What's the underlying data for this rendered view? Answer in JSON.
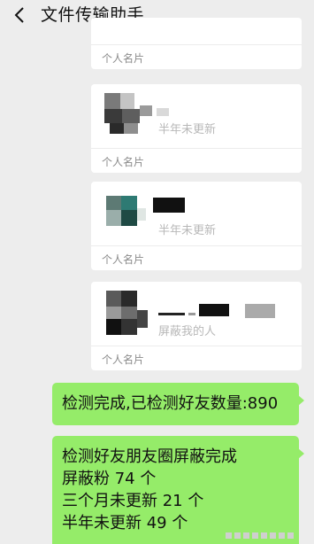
{
  "header": {
    "title": "文件传输助手",
    "back_icon": "chevron-left-icon"
  },
  "cards": [
    {
      "label": "个人名片",
      "status": ""
    },
    {
      "label": "个人名片",
      "status": "半年未更新"
    },
    {
      "label": "个人名片",
      "status": "半年未更新"
    },
    {
      "label": "个人名片",
      "status": "屏蔽我的人"
    }
  ],
  "messages": [
    {
      "lines": [
        "检测完成,已检测好友数量:890"
      ]
    },
    {
      "lines": [
        "检测好友朋友圈屏蔽完成",
        "屏蔽粉 74 个",
        "三个月未更新 21 个",
        "半年未更新 49 个"
      ]
    }
  ],
  "colors": {
    "background": "#ededed",
    "bubble": "#95ec69",
    "card": "#ffffff"
  }
}
